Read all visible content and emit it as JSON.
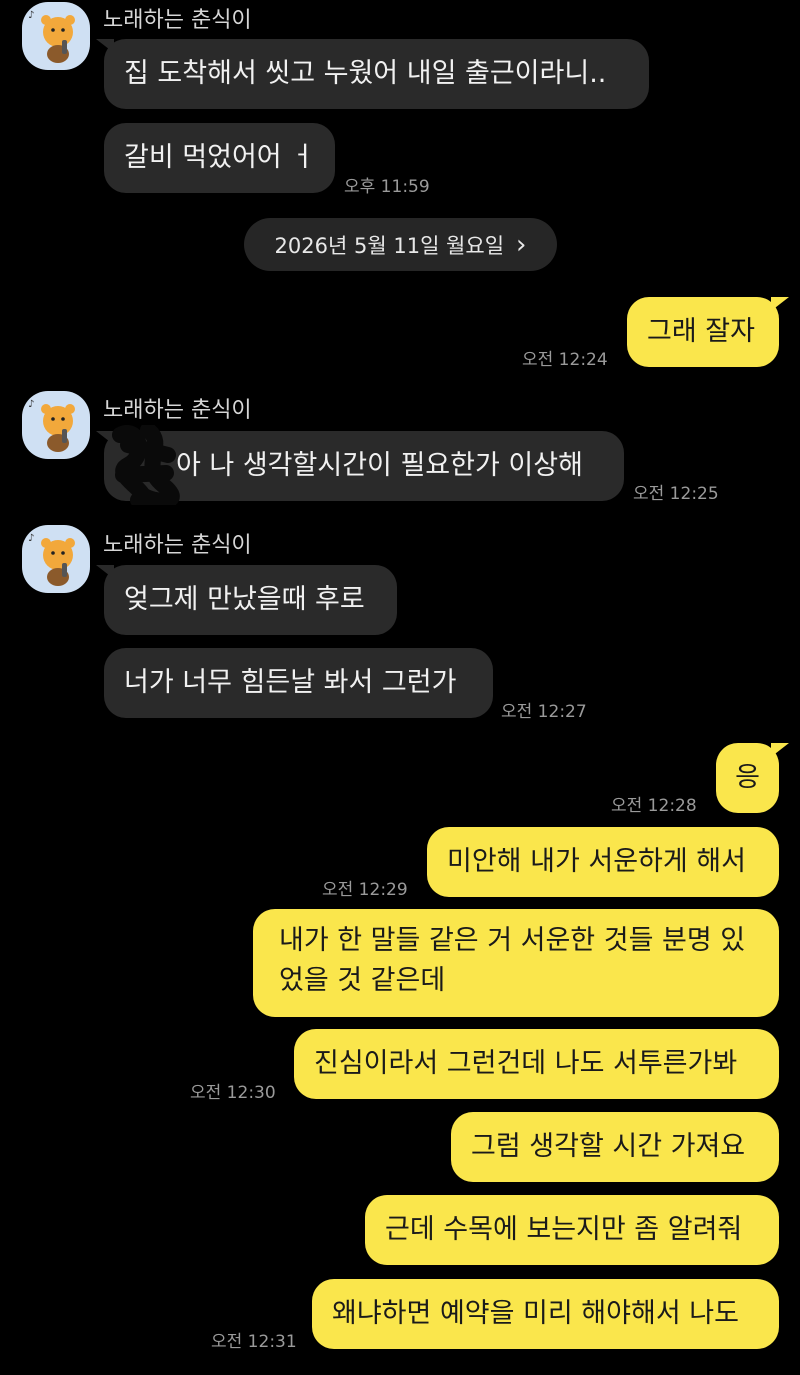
{
  "chat": {
    "sender_name": "노래하는 춘식이",
    "colors": {
      "incoming": "#2a2a2a",
      "outgoing": "#fae64c",
      "background": "#000000"
    },
    "messages": [
      {
        "text": "집 도착해서 씻고 누웠어 내일 출근이라니.."
      },
      {
        "text": "갈비 먹었어어 ㅓ",
        "time": "오후 11:59"
      },
      {
        "text": "그래 잘자",
        "time": "오전 12:24"
      },
      {
        "text": "아 나 생각할시간이 필요한가 이상해",
        "time": "오전 12:25"
      },
      {
        "text": "엊그제 만났을때 후로"
      },
      {
        "text": "너가 너무 힘든날 봐서 그런가",
        "time": "오전 12:27"
      },
      {
        "text": "응",
        "time": "오전 12:28"
      },
      {
        "text": "미안해 내가 서운하게 해서",
        "time": "오전 12:29"
      },
      {
        "text": "내가 한 말들 같은 거 서운한 것들 분명 있었을 것 같은데"
      },
      {
        "text": "진심이라서 그런건데 나도 서투른가봐",
        "time": "오전 12:30"
      },
      {
        "text": "그럼 생각할 시간 가져요"
      },
      {
        "text": "근데 수목에 보는지만 좀 알려줘"
      },
      {
        "text": "왜냐하면 예약을 미리 해야해서 나도",
        "time": "오전 12:31"
      }
    ],
    "date_divider": "2026년 5월 11일 월요일",
    "date_chevron": "›"
  }
}
